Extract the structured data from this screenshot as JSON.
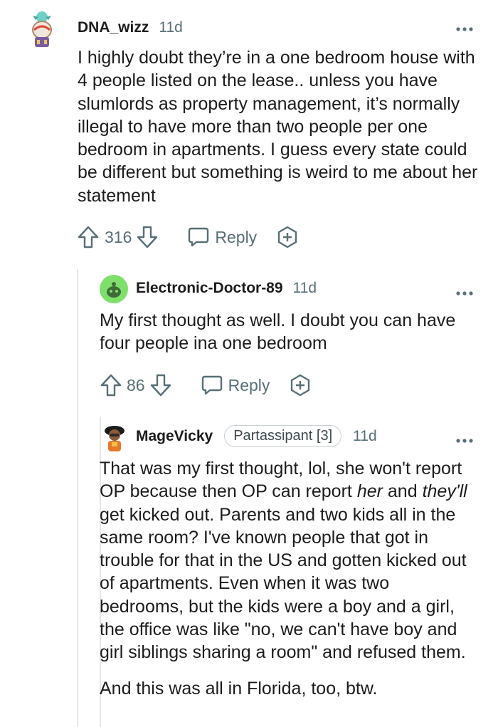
{
  "comments": [
    {
      "username": "DNA_wizz",
      "time": "11d",
      "text": "I highly doubt they’re in a one bedroom house with 4 people listed on the lease.. unless you have slumlords as property management, it’s normally illegal to have more than two people per one bedroom in apartments. I guess every state could be different but something is weird to me about her statement",
      "votes": "316",
      "reply_label": "Reply"
    },
    {
      "username": "Electronic-Doctor-89",
      "time": "11d",
      "text": "My first thought as well. I doubt you can have four people ina one bedroom",
      "votes": "86",
      "reply_label": "Reply"
    },
    {
      "username": "MageVicky",
      "flair": "Partassipant [3]",
      "time": "11d",
      "text_parts": [
        "That was my first thought, lol, she won't report OP because then OP can report ",
        "her",
        " and ",
        "they'll",
        " get kicked out. Parents and two kids all in the same room? I've known people that got in trouble for that in the US and gotten kicked out of apartments. Even when it was two bedrooms, but the kids were a boy and a girl, the office was like \"no, we can't have boy and girl siblings sharing a room\" and refused them."
      ],
      "text_2": "And this was all in Florida, too, btw."
    }
  ],
  "icons": {
    "more": "more-options-icon",
    "upvote": "upvote-arrow-icon",
    "downvote": "downvote-arrow-icon",
    "reply": "reply-bubble-icon",
    "award": "award-plus-icon"
  },
  "colors": {
    "text": "#1c1c1c",
    "meta": "#576f76",
    "thread_line": "#e4e6e8"
  }
}
